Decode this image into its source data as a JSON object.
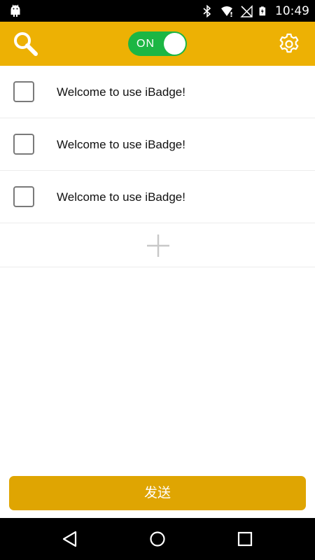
{
  "status_bar": {
    "time": "10:49",
    "icons": [
      "android-icon",
      "bluetooth-icon",
      "wifi-icon",
      "no-signal-icon",
      "battery-charging-icon"
    ]
  },
  "app_bar": {
    "background": "#EDB104",
    "search_icon": "search-icon",
    "toggle": {
      "label": "ON",
      "state": "on",
      "color": "#1CB644"
    },
    "settings_icon": "gear-icon"
  },
  "list": {
    "items": [
      {
        "text": "Welcome to use iBadge!",
        "checked": false
      },
      {
        "text": "Welcome to use iBadge!",
        "checked": false
      },
      {
        "text": "Welcome to use iBadge!",
        "checked": false
      }
    ],
    "add_icon": "plus-icon"
  },
  "send_button": {
    "label": "发送",
    "color": "#DFA502"
  },
  "nav_bar": {
    "icons": [
      "back-icon",
      "home-icon",
      "recent-apps-icon"
    ]
  }
}
